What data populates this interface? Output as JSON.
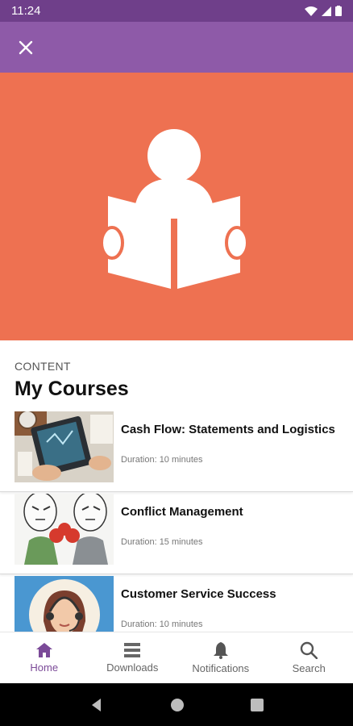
{
  "status_bar": {
    "time": "11:24"
  },
  "app_bar": {
    "close_icon": "close-icon"
  },
  "hero": {
    "icon": "reader-icon",
    "color": "#ee7151"
  },
  "content": {
    "section_label": "CONTENT",
    "section_title": "My Courses",
    "courses": [
      {
        "title": "Cash Flow: Statements and Logistics",
        "duration": "Duration: 10 minutes"
      },
      {
        "title": "Conflict Management",
        "duration": "Duration: 15 minutes"
      },
      {
        "title": "Customer Service Success",
        "duration": "Duration: 10 minutes"
      }
    ]
  },
  "bottom_nav": {
    "items": [
      {
        "label": "Home",
        "icon": "home-icon",
        "active": true
      },
      {
        "label": "Downloads",
        "icon": "downloads-icon",
        "active": false
      },
      {
        "label": "Notifications",
        "icon": "bell-icon",
        "active": false
      },
      {
        "label": "Search",
        "icon": "search-icon",
        "active": false
      }
    ]
  },
  "colors": {
    "status_bar": "#6f3f8a",
    "app_bar": "#8e5aa8",
    "accent": "#7b4a98"
  }
}
